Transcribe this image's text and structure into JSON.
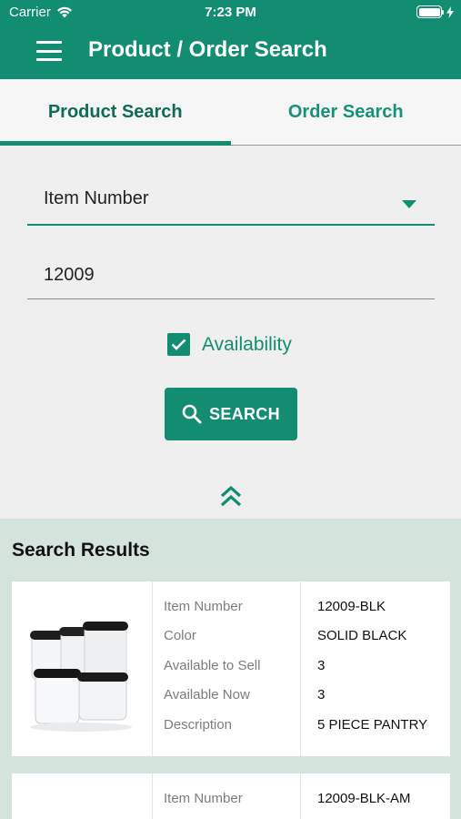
{
  "status_bar": {
    "carrier": "Carrier",
    "time": "7:23 PM"
  },
  "app_bar": {
    "title": "Product / Order Search"
  },
  "tabs": [
    {
      "label": "Product Search",
      "active": true
    },
    {
      "label": "Order Search",
      "active": false
    }
  ],
  "form": {
    "search_type": "Item Number",
    "query_value": "12009",
    "availability_label": "Availability",
    "availability_checked": true,
    "search_button_label": "SEARCH"
  },
  "results": {
    "title": "Search Results",
    "field_labels": [
      "Item Number",
      "Color",
      "Available to Sell",
      "Available Now",
      "Description"
    ],
    "items": [
      {
        "image": "pantry-containers-image",
        "values": [
          "12009-BLK",
          "SOLID BLACK",
          "3",
          "3",
          "5 PIECE PANTRY"
        ]
      },
      {
        "image": "",
        "values": [
          "12009-BLK-AM"
        ]
      }
    ]
  },
  "colors": {
    "primary": "#138d72",
    "results_background": "#d5e3dd",
    "page_background": "#efefef"
  }
}
